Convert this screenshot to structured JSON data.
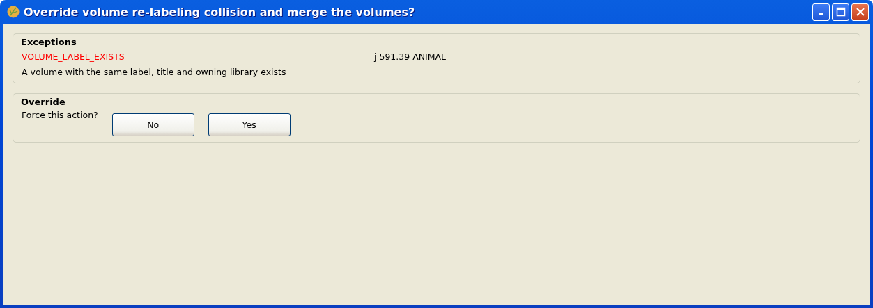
{
  "window": {
    "title": "Override volume re-labeling collision and merge the volumes?"
  },
  "exceptions": {
    "heading": "Exceptions",
    "items": [
      {
        "code": "VOLUME_LABEL_EXISTS",
        "value": "j 591.39 ANIMAL",
        "description": "A volume with the same label, title and owning library exists"
      }
    ]
  },
  "override": {
    "heading": "Override",
    "prompt": "Force this action?",
    "buttons": [
      "No",
      "Yes"
    ]
  }
}
